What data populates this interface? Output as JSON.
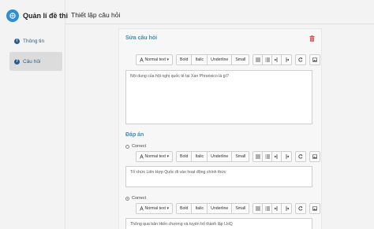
{
  "app": {
    "title": "Quản lí đề thi"
  },
  "sidebar": {
    "items": [
      {
        "label": "Thông tin",
        "icon": "info-icon",
        "active": false
      },
      {
        "label": "Câu hỏi",
        "icon": "help-icon",
        "active": true
      }
    ]
  },
  "page": {
    "title": "Thiết lập câu hỏi"
  },
  "question": {
    "section_title": "Sửa câu hỏi",
    "content": "Nội dung của hội nghị quốc tế tại Xan Phranxico là gì?"
  },
  "toolbar": {
    "normal_text": "Normal text",
    "bold": "Bold",
    "italic": "Italic",
    "underline": "Underline",
    "small": "Small"
  },
  "answers": {
    "section_title": "Đáp án",
    "items": [
      {
        "label": "Correct",
        "checked": false,
        "text": "Tổ chức Liên Hợp Quốc đi vào hoạt động chính thức"
      },
      {
        "label": "Correct",
        "checked": true,
        "text": "Thông qua bản Hiến chương và tuyên bố thành lập LHQ"
      }
    ]
  },
  "colors": {
    "accent": "#3c8dbc",
    "danger": "#d9534f",
    "sidebar_active": "#dcdcdc"
  }
}
